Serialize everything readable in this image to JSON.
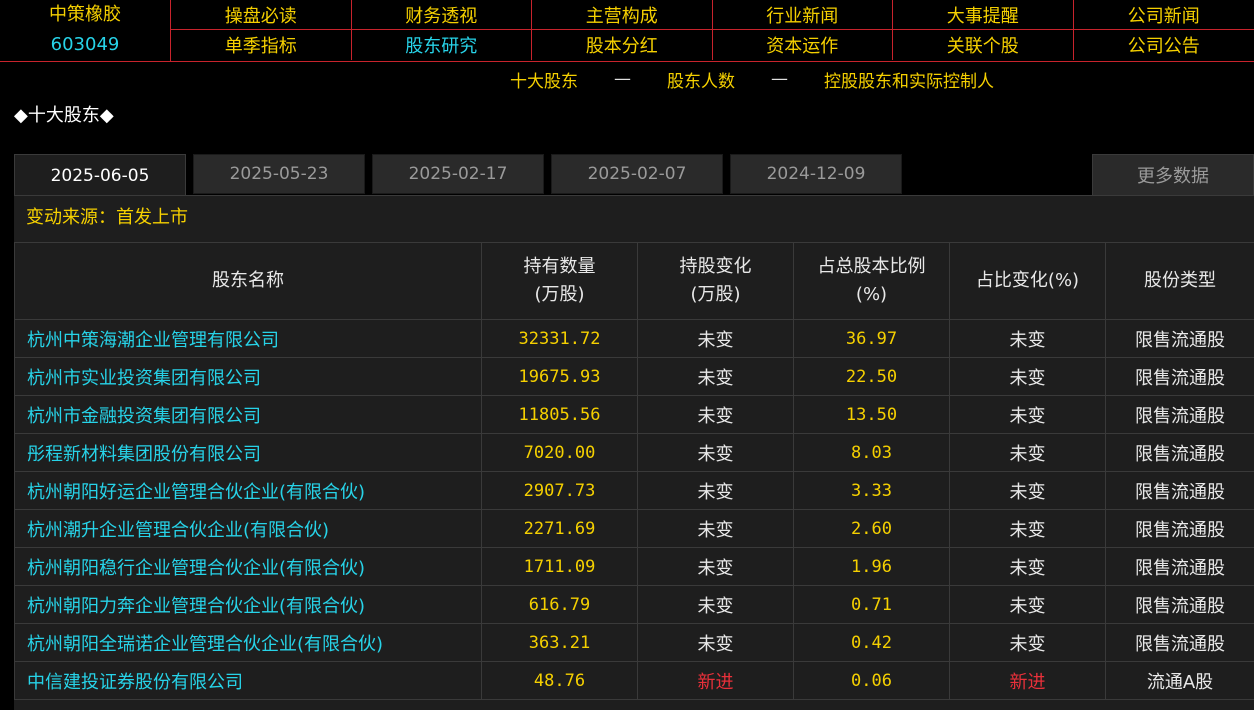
{
  "stock": {
    "name": "中策橡胶",
    "code": "603049"
  },
  "nav": {
    "row1": [
      "操盘必读",
      "财务透视",
      "主营构成",
      "行业新闻",
      "大事提醒",
      "公司新闻"
    ],
    "row2": [
      "单季指标",
      "股东研究",
      "股本分红",
      "资本运作",
      "关联个股",
      "公司公告"
    ],
    "active": "股东研究"
  },
  "subnav": {
    "items": [
      "十大股东",
      "股东人数",
      "控股股东和实际控制人"
    ],
    "separator": "—"
  },
  "section_title": "◆十大股东◆",
  "date_tabs": [
    "2025-06-05",
    "2025-05-23",
    "2025-02-17",
    "2025-02-07",
    "2024-12-09"
  ],
  "active_tab": "2025-06-05",
  "more_button": "更多数据",
  "change_source": "变动来源：首发上市",
  "table": {
    "headers": [
      {
        "line1": "股东名称",
        "line2": ""
      },
      {
        "line1": "持有数量",
        "line2": "(万股)"
      },
      {
        "line1": "持股变化",
        "line2": "(万股)"
      },
      {
        "line1": "占总股本比例",
        "line2": "(%)"
      },
      {
        "line1": "占比变化(%)",
        "line2": ""
      },
      {
        "line1": "股份类型",
        "line2": ""
      }
    ],
    "rows": [
      {
        "name": "杭州中策海潮企业管理有限公司",
        "shares": "32331.72",
        "change": "未变",
        "ratio": "36.97",
        "ratio_change": "未变",
        "type": "限售流通股"
      },
      {
        "name": "杭州市实业投资集团有限公司",
        "shares": "19675.93",
        "change": "未变",
        "ratio": "22.50",
        "ratio_change": "未变",
        "type": "限售流通股"
      },
      {
        "name": "杭州市金融投资集团有限公司",
        "shares": "11805.56",
        "change": "未变",
        "ratio": "13.50",
        "ratio_change": "未变",
        "type": "限售流通股"
      },
      {
        "name": "彤程新材料集团股份有限公司",
        "shares": "7020.00",
        "change": "未变",
        "ratio": "8.03",
        "ratio_change": "未变",
        "type": "限售流通股"
      },
      {
        "name": "杭州朝阳好运企业管理合伙企业(有限合伙)",
        "shares": "2907.73",
        "change": "未变",
        "ratio": "3.33",
        "ratio_change": "未变",
        "type": "限售流通股"
      },
      {
        "name": "杭州潮升企业管理合伙企业(有限合伙)",
        "shares": "2271.69",
        "change": "未变",
        "ratio": "2.60",
        "ratio_change": "未变",
        "type": "限售流通股"
      },
      {
        "name": "杭州朝阳稳行企业管理合伙企业(有限合伙)",
        "shares": "1711.09",
        "change": "未变",
        "ratio": "1.96",
        "ratio_change": "未变",
        "type": "限售流通股"
      },
      {
        "name": "杭州朝阳力奔企业管理合伙企业(有限合伙)",
        "shares": "616.79",
        "change": "未变",
        "ratio": "0.71",
        "ratio_change": "未变",
        "type": "限售流通股"
      },
      {
        "name": "杭州朝阳全瑞诺企业管理合伙企业(有限合伙)",
        "shares": "363.21",
        "change": "未变",
        "ratio": "0.42",
        "ratio_change": "未变",
        "type": "限售流通股"
      },
      {
        "name": "中信建投证券股份有限公司",
        "shares": "48.76",
        "change": "新进",
        "ratio": "0.06",
        "ratio_change": "新进",
        "type": "流通A股"
      }
    ]
  },
  "colors": {
    "accent_yellow": "#f5d000",
    "link_cyan": "#27d3e8",
    "border_red": "#c8232c",
    "new_red": "#e8303a"
  }
}
